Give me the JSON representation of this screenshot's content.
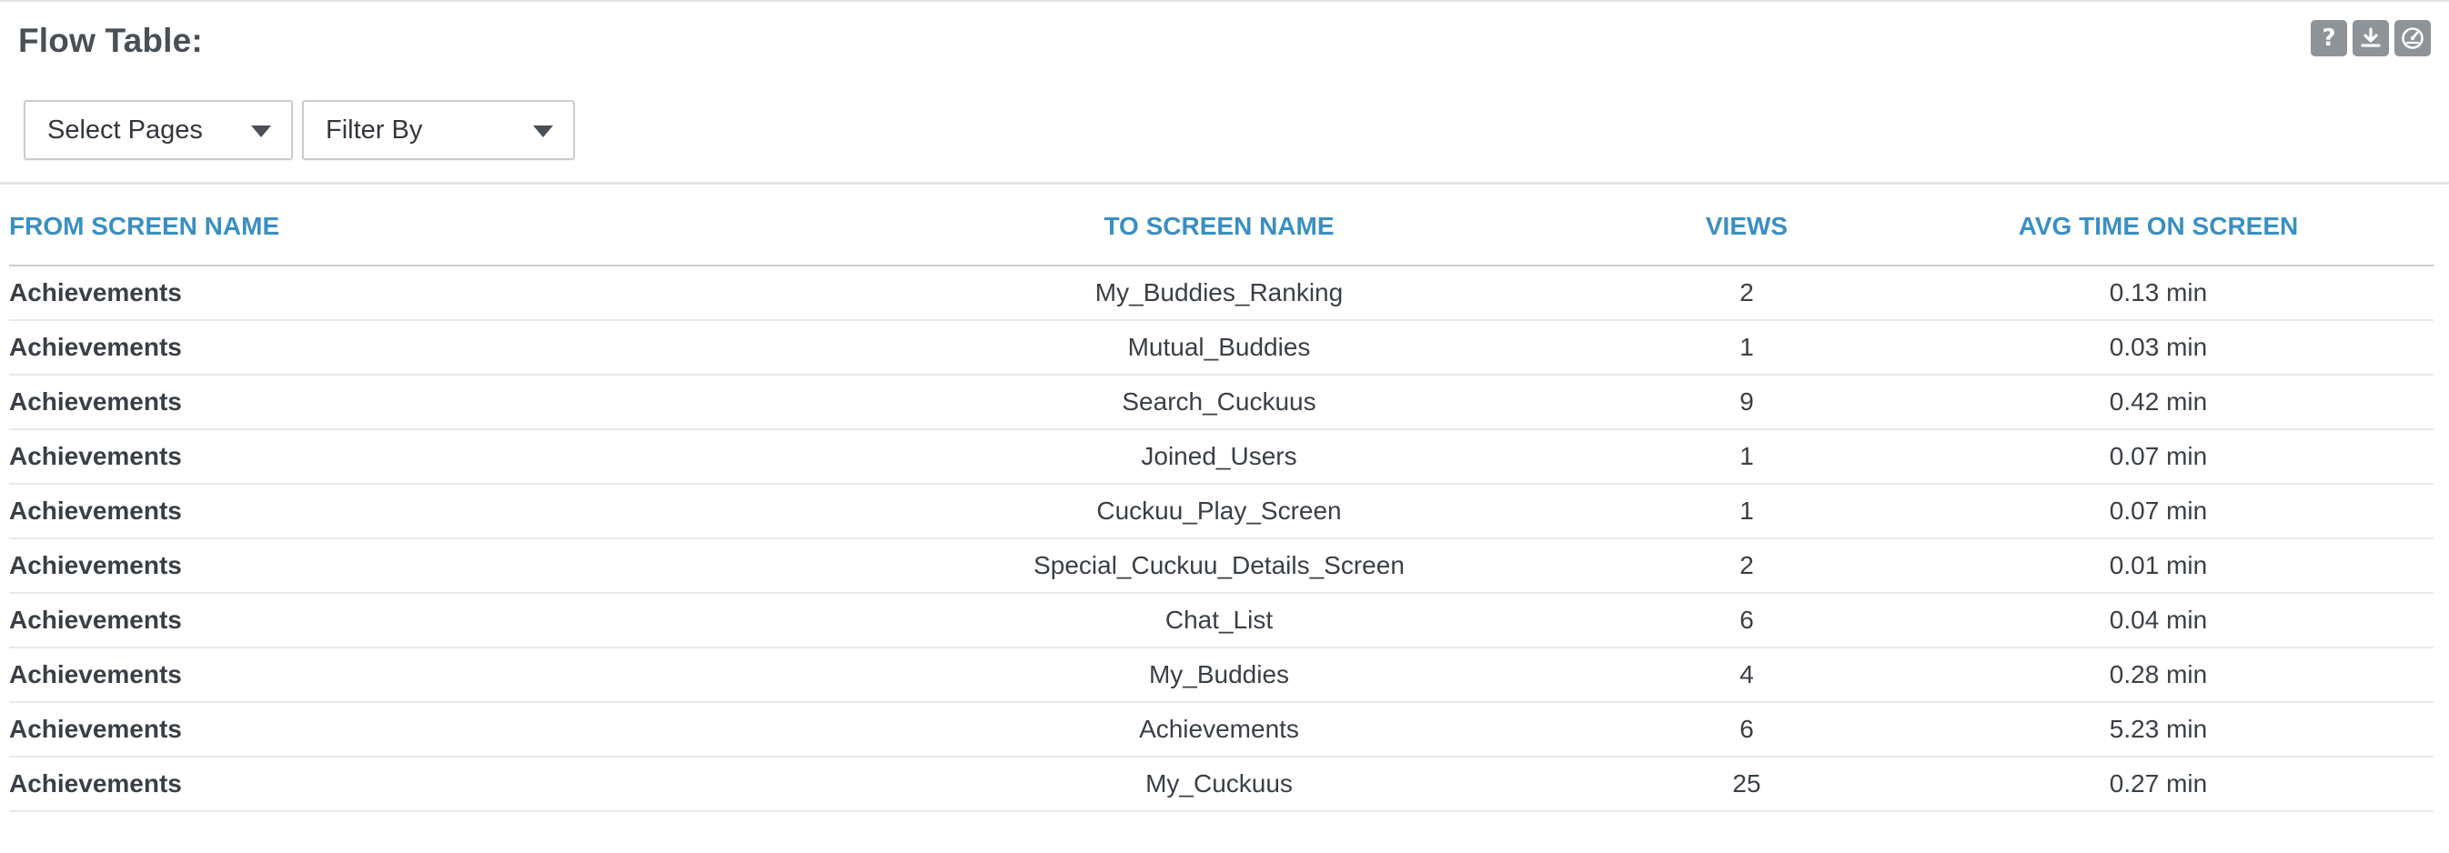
{
  "panel": {
    "title": "Flow Table:",
    "icons": [
      "help-icon",
      "download-icon",
      "dashboard-icon"
    ],
    "help_glyph": "?"
  },
  "filters": {
    "pages_label": "Select Pages",
    "filter_label": "Filter By"
  },
  "table": {
    "columns": [
      "FROM SCREEN NAME",
      "TO SCREEN NAME",
      "VIEWS",
      "AVG TIME ON SCREEN"
    ],
    "rows": [
      {
        "from": "Achievements",
        "to": "My_Buddies_Ranking",
        "views": "2",
        "avg": "0.13 min"
      },
      {
        "from": "Achievements",
        "to": "Mutual_Buddies",
        "views": "1",
        "avg": "0.03 min"
      },
      {
        "from": "Achievements",
        "to": "Search_Cuckuus",
        "views": "9",
        "avg": "0.42 min"
      },
      {
        "from": "Achievements",
        "to": "Joined_Users",
        "views": "1",
        "avg": "0.07 min"
      },
      {
        "from": "Achievements",
        "to": "Cuckuu_Play_Screen",
        "views": "1",
        "avg": "0.07 min"
      },
      {
        "from": "Achievements",
        "to": "Special_Cuckuu_Details_Screen",
        "views": "2",
        "avg": "0.01 min"
      },
      {
        "from": "Achievements",
        "to": "Chat_List",
        "views": "6",
        "avg": "0.04 min"
      },
      {
        "from": "Achievements",
        "to": "My_Buddies",
        "views": "4",
        "avg": "0.28 min"
      },
      {
        "from": "Achievements",
        "to": "Achievements",
        "views": "6",
        "avg": "5.23 min"
      },
      {
        "from": "Achievements",
        "to": "My_Cuckuus",
        "views": "25",
        "avg": "0.27 min"
      }
    ]
  },
  "colors": {
    "header_text": "#3a8fc2",
    "icon_bg": "#8e9398"
  }
}
